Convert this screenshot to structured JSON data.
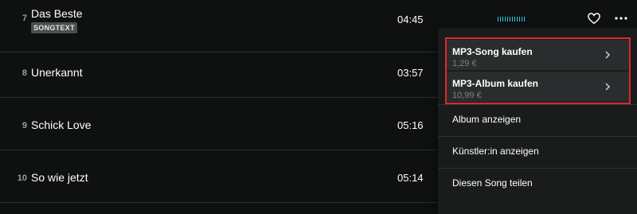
{
  "tracks": [
    {
      "number": "7",
      "title": "Das Beste",
      "badge": "SONGTEXT",
      "duration": "04:45"
    },
    {
      "number": "8",
      "title": "Unerkannt",
      "duration": "03:57"
    },
    {
      "number": "9",
      "title": "Schick Love",
      "duration": "05:16"
    },
    {
      "number": "10",
      "title": "So wie jetzt",
      "duration": "05:14"
    }
  ],
  "row_controls": {
    "now_playing_icon": "equalizer-icon",
    "favorite_icon": "heart-icon",
    "more_icon": "more-options-icon"
  },
  "context_menu": {
    "buy_song": {
      "label": "MP3-Song kaufen",
      "price": "1,29 €"
    },
    "buy_album": {
      "label": "MP3-Album kaufen",
      "price": "10,99 €"
    },
    "items": [
      "Album anzeigen",
      "Künstler:in anzeigen",
      "Diesen Song teilen"
    ]
  },
  "colors": {
    "background": "#0f1111",
    "accent": "#25d1da",
    "highlight_border": "#e0262d"
  }
}
